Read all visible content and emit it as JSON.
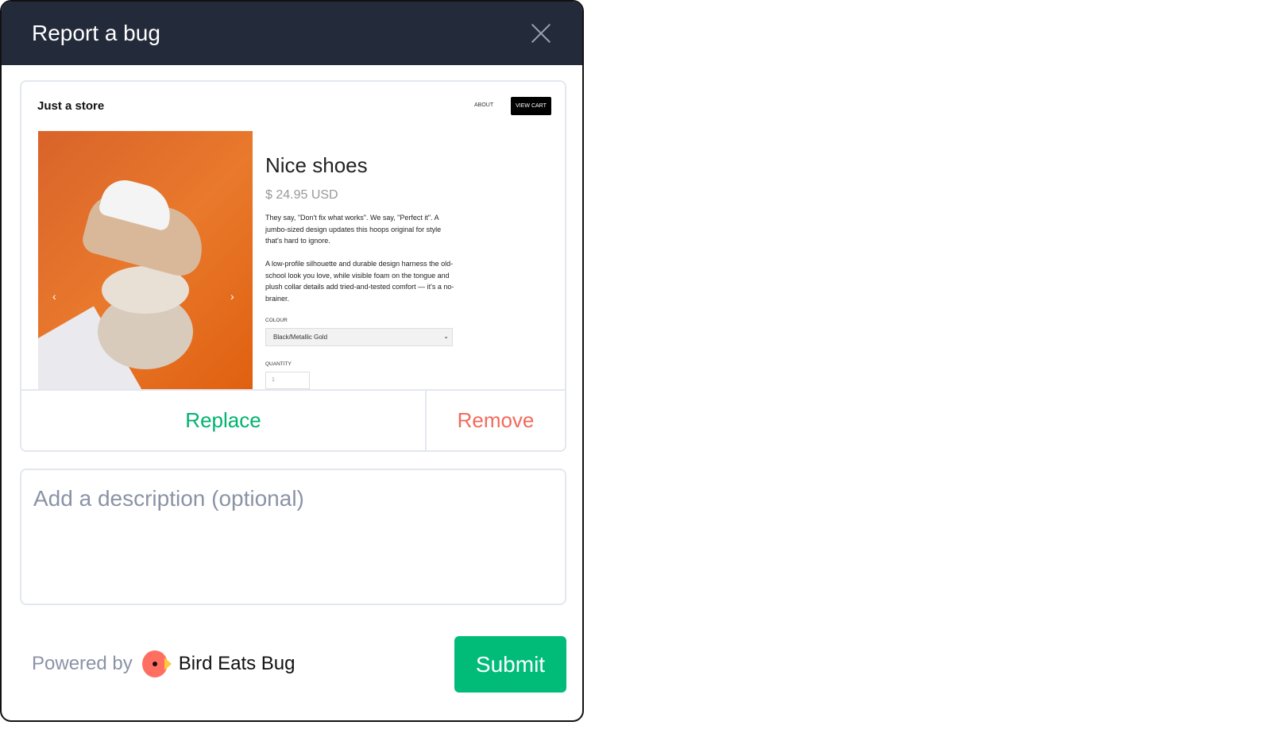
{
  "dialog": {
    "title": "Report a bug",
    "close_icon": "close-icon"
  },
  "screenshot": {
    "store_name": "Just a store",
    "nav_about": "ABOUT",
    "nav_view_cart": "VIEW CART",
    "product_name": "Nice shoes",
    "price": "$ 24.95 USD",
    "desc1": "They say, \"Don't fix what works\". We say, \"Perfect it\". A jumbo-sized design updates this hoops original for style that's hard to ignore.",
    "desc2": "A low-profile silhouette and durable design harness the old-school look you love, while visible foam on the tongue and plush collar details add tried-and-tested comfort — it's a no-brainer.",
    "colour_label": "COLOUR",
    "colour_value": "Black/Metallic Gold",
    "quantity_label": "QUANTITY",
    "quantity_value": "1",
    "prev": "‹",
    "next": "›"
  },
  "actions": {
    "replace": "Replace",
    "remove": "Remove"
  },
  "description": {
    "placeholder": "Add a description (optional)",
    "value": ""
  },
  "footer": {
    "powered_by": "Powered by",
    "brand": "Bird Eats Bug",
    "submit": "Submit"
  },
  "colors": {
    "header": "#232a3a",
    "accent_green": "#00bc78",
    "remove_red": "#f26b5b"
  }
}
